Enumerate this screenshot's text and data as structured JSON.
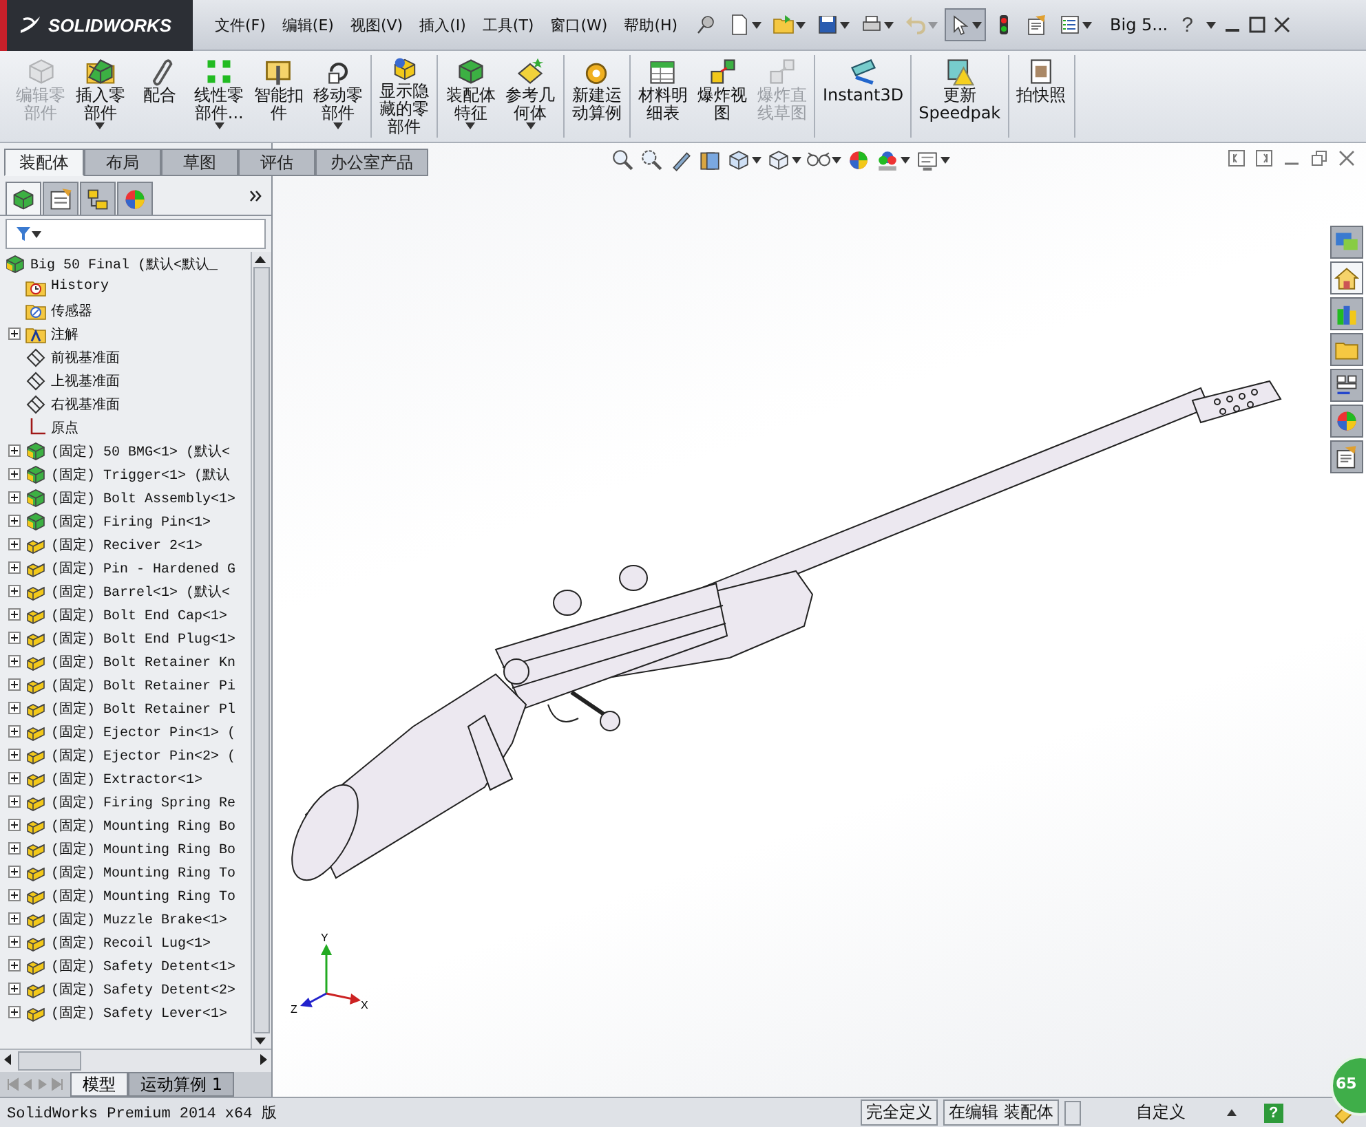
{
  "title_bar": {
    "logo": "SOLIDWORKS",
    "menus": [
      "文件(F)",
      "编辑(E)",
      "视图(V)",
      "插入(I)",
      "工具(T)",
      "窗口(W)",
      "帮助(H)"
    ],
    "quick_access": [
      {
        "kind": "pin",
        "dropdown": false,
        "disabled": false,
        "pressed": false
      },
      {
        "kind": "new",
        "dropdown": true,
        "disabled": false,
        "pressed": false
      },
      {
        "kind": "open",
        "dropdown": true,
        "disabled": false,
        "pressed": false
      },
      {
        "kind": "save",
        "dropdown": true,
        "disabled": false,
        "pressed": false
      },
      {
        "kind": "print",
        "dropdown": true,
        "disabled": false,
        "pressed": false
      },
      {
        "kind": "undo",
        "dropdown": true,
        "disabled": true,
        "pressed": false
      },
      {
        "kind": "select",
        "dropdown": true,
        "disabled": false,
        "pressed": true
      },
      {
        "kind": "rebuild",
        "dropdown": false,
        "disabled": false,
        "pressed": false
      },
      {
        "kind": "options",
        "dropdown": false,
        "disabled": false,
        "pressed": false
      },
      {
        "kind": "properties",
        "dropdown": true,
        "disabled": false,
        "pressed": false
      }
    ],
    "document_title": "Big 5...",
    "help": "?"
  },
  "ribbon": {
    "groups": [
      {
        "buttons": [
          {
            "kind": "edit-component",
            "label": "编辑零部件",
            "disabled": true,
            "dropdown": false
          },
          {
            "kind": "insert-component",
            "label": "插入零部件",
            "disabled": false,
            "dropdown": true
          },
          {
            "kind": "mate",
            "label": "配合",
            "disabled": false,
            "dropdown": false
          },
          {
            "kind": "linear-pattern",
            "label": "线性零部件...",
            "disabled": false,
            "dropdown": true
          },
          {
            "kind": "fastener",
            "label": "智能扣件",
            "disabled": false,
            "dropdown": false
          },
          {
            "kind": "move",
            "label": "移动零部件",
            "disabled": false,
            "dropdown": true
          }
        ]
      },
      {
        "buttons": [
          {
            "kind": "show-hidden",
            "label": "显示隐藏的零部件",
            "disabled": false,
            "dropdown": false
          }
        ]
      },
      {
        "buttons": [
          {
            "kind": "assembly-feature",
            "label": "装配体特征",
            "disabled": false,
            "dropdown": true
          },
          {
            "kind": "reference",
            "label": "参考几何体",
            "disabled": false,
            "dropdown": true
          }
        ]
      },
      {
        "buttons": [
          {
            "kind": "motion",
            "label": "新建运动算例",
            "disabled": false,
            "dropdown": false
          }
        ]
      },
      {
        "buttons": [
          {
            "kind": "bom",
            "label": "材料明细表",
            "disabled": false,
            "dropdown": false
          },
          {
            "kind": "explode",
            "label": "爆炸视图",
            "disabled": false,
            "dropdown": false
          },
          {
            "kind": "explode-line",
            "label": "爆炸直线草图",
            "disabled": true,
            "dropdown": false
          }
        ]
      },
      {
        "buttons": [
          {
            "kind": "instant3d",
            "label": "Instant3D",
            "disabled": false,
            "dropdown": false
          }
        ]
      },
      {
        "buttons": [
          {
            "kind": "speedpak",
            "label": "更新 Speedpak",
            "disabled": false,
            "dropdown": false
          }
        ]
      },
      {
        "buttons": [
          {
            "kind": "snapshot",
            "label": "拍快照",
            "disabled": false,
            "dropdown": false
          }
        ]
      }
    ]
  },
  "command_tabs": [
    {
      "label": "装配体",
      "selected": true
    },
    {
      "label": "布局",
      "selected": false
    },
    {
      "label": "草图",
      "selected": false
    },
    {
      "label": "评估",
      "selected": false
    },
    {
      "label": "办公室产品",
      "selected": false
    }
  ],
  "feature_manager": {
    "panel_tabs": [
      {
        "kind": "feature-tree",
        "selected": true
      },
      {
        "kind": "property",
        "selected": false
      },
      {
        "kind": "configuration",
        "selected": false
      },
      {
        "kind": "display",
        "selected": false
      }
    ],
    "tree": {
      "kind": "assembly",
      "label": "Big 50 Final (默认<默认_",
      "collapsed": false,
      "children": [
        {
          "kind": "history",
          "label": "History",
          "collapsed": false
        },
        {
          "kind": "sensor",
          "label": "传感器",
          "collapsed": false
        },
        {
          "kind": "annotation",
          "label": "注解",
          "collapsed": true
        },
        {
          "kind": "plane",
          "label": "前视基准面",
          "collapsed": false
        },
        {
          "kind": "plane",
          "label": "上视基准面",
          "collapsed": false
        },
        {
          "kind": "plane",
          "label": "右视基准面",
          "collapsed": false
        },
        {
          "kind": "origin",
          "label": "原点",
          "collapsed": false
        },
        {
          "kind": "assembly",
          "label": "(固定) 50 BMG<1> (默认<",
          "collapsed": true
        },
        {
          "kind": "assembly",
          "label": "(固定) Trigger<1> (默认",
          "collapsed": true
        },
        {
          "kind": "assembly",
          "label": "(固定) Bolt Assembly<1>",
          "collapsed": true
        },
        {
          "kind": "assembly",
          "label": "(固定) Firing Pin<1>",
          "collapsed": true
        },
        {
          "kind": "part",
          "label": "(固定) Reciver 2<1>",
          "collapsed": true
        },
        {
          "kind": "part",
          "label": "(固定) Pin - Hardened G",
          "collapsed": true
        },
        {
          "kind": "part",
          "label": "(固定) Barrel<1> (默认<",
          "collapsed": true
        },
        {
          "kind": "part",
          "label": "(固定) Bolt End Cap<1>",
          "collapsed": true
        },
        {
          "kind": "part",
          "label": "(固定) Bolt End Plug<1>",
          "collapsed": true
        },
        {
          "kind": "part",
          "label": "(固定) Bolt Retainer Kn",
          "collapsed": true
        },
        {
          "kind": "part",
          "label": "(固定) Bolt Retainer Pi",
          "collapsed": true
        },
        {
          "kind": "part",
          "label": "(固定) Bolt Retainer Pl",
          "collapsed": true
        },
        {
          "kind": "part",
          "label": "(固定) Ejector Pin<1> (",
          "collapsed": true
        },
        {
          "kind": "part",
          "label": "(固定) Ejector Pin<2> (",
          "collapsed": true
        },
        {
          "kind": "part",
          "label": "(固定) Extractor<1>",
          "collapsed": true
        },
        {
          "kind": "part",
          "label": "(固定) Firing Spring Re",
          "collapsed": true
        },
        {
          "kind": "part",
          "label": "(固定) Mounting Ring Bo",
          "collapsed": true
        },
        {
          "kind": "part",
          "label": "(固定) Mounting Ring Bo",
          "collapsed": true
        },
        {
          "kind": "part",
          "label": "(固定) Mounting Ring To",
          "collapsed": true
        },
        {
          "kind": "part",
          "label": "(固定) Mounting Ring To",
          "collapsed": true
        },
        {
          "kind": "part",
          "label": "(固定) Muzzle Brake<1>",
          "collapsed": true
        },
        {
          "kind": "part",
          "label": "(固定) Recoil Lug<1>",
          "collapsed": true
        },
        {
          "kind": "part",
          "label": "(固定) Safety Detent<1>",
          "collapsed": true
        },
        {
          "kind": "part",
          "label": "(固定) Safety Detent<2>",
          "collapsed": true
        },
        {
          "kind": "part",
          "label": "(固定) Safety Lever<1>",
          "collapsed": true
        }
      ]
    },
    "bottom_tabs": [
      {
        "label": "模型",
        "selected": true
      },
      {
        "label": "运动算例 1",
        "selected": false
      }
    ]
  },
  "viewport": {
    "view_toolbar": [
      {
        "kind": "zoom-fit",
        "dropdown": false
      },
      {
        "kind": "zoom-area",
        "dropdown": false
      },
      {
        "kind": "previous-view",
        "dropdown": false
      },
      {
        "kind": "section",
        "dropdown": false
      },
      {
        "kind": "orientation",
        "dropdown": true
      },
      {
        "kind": "display-style",
        "dropdown": true
      },
      {
        "kind": "hide-show",
        "dropdown": true
      },
      {
        "kind": "appearance",
        "dropdown": false
      },
      {
        "kind": "scene",
        "dropdown": true
      },
      {
        "kind": "view-settings",
        "dropdown": true
      }
    ],
    "task_pane": [
      {
        "kind": "resources",
        "selected": false
      },
      {
        "kind": "home",
        "selected": true
      },
      {
        "kind": "library",
        "selected": false
      },
      {
        "kind": "folder",
        "selected": false
      },
      {
        "kind": "palette",
        "selected": false
      },
      {
        "kind": "appearance",
        "selected": false
      },
      {
        "kind": "properties",
        "selected": false
      }
    ],
    "triad": {
      "y": "Y",
      "x": "X",
      "z": "Z"
    },
    "badge": "65"
  },
  "status_bar": {
    "product": "SolidWorks Premium 2014 x64 版",
    "segments": [
      "完全定义",
      "在编辑 装配体"
    ],
    "units": "自定义",
    "help": "?"
  }
}
